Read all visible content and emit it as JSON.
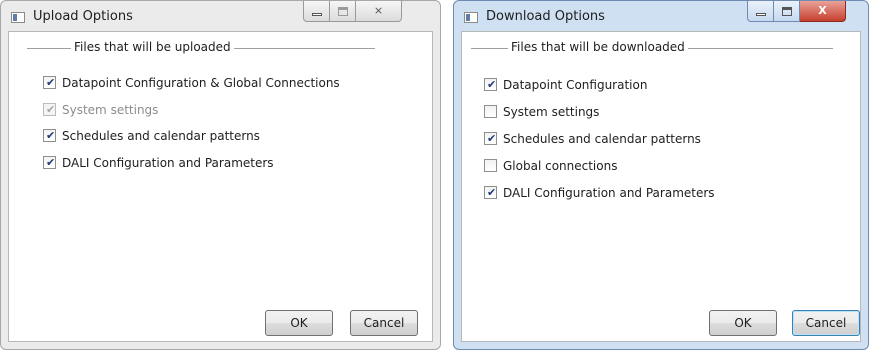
{
  "upload_dialog": {
    "title": "Upload Options",
    "group_label": "Files that will be uploaded",
    "options": [
      {
        "label": "Datapoint Configuration & Global Connections",
        "checked": true,
        "enabled": true
      },
      {
        "label": "System settings",
        "checked": true,
        "enabled": false
      },
      {
        "label": "Schedules and calendar patterns",
        "checked": true,
        "enabled": true
      },
      {
        "label": "DALI Configuration and Parameters",
        "checked": true,
        "enabled": true
      }
    ],
    "ok_label": "OK",
    "cancel_label": "Cancel",
    "close_glyph": "⨯"
  },
  "download_dialog": {
    "title": "Download Options",
    "group_label": "Files that will be downloaded",
    "options": [
      {
        "label": "Datapoint Configuration",
        "checked": true,
        "enabled": true
      },
      {
        "label": "System settings",
        "checked": false,
        "enabled": true
      },
      {
        "label": "Schedules and calendar patterns",
        "checked": true,
        "enabled": true
      },
      {
        "label": "Global connections",
        "checked": false,
        "enabled": true
      },
      {
        "label": "DALI Configuration and Parameters",
        "checked": true,
        "enabled": true
      }
    ],
    "ok_label": "OK",
    "cancel_label": "Cancel",
    "close_glyph": "X"
  },
  "glyphs": {
    "check": "✔"
  },
  "colors": {
    "active_frame": "#cfe0f2",
    "inactive_frame": "#ebebeb",
    "close_button_active": "#c7402e",
    "check_color": "#20387a"
  }
}
